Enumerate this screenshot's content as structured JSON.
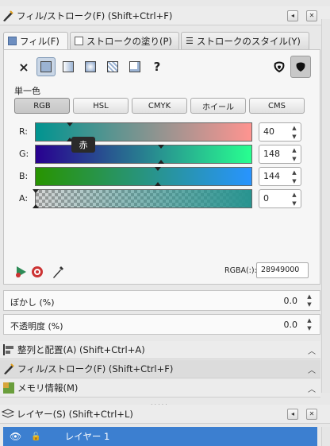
{
  "fill_stroke_panel": {
    "title": "フィル/ストローク(F) (Shift+Ctrl+F)",
    "tabs": [
      "フィル(F)",
      "ストロークの塗り(P)",
      "ストロークのスタイル(Y)"
    ],
    "paint_buttons": {
      "none": "×",
      "flat": "flat-color",
      "linear": "linear-gradient",
      "radial": "radial-gradient",
      "pattern": "pattern",
      "swatch": "swatch",
      "unset": "?"
    },
    "section_label": "単一色",
    "modes": [
      "RGB",
      "HSL",
      "CMYK",
      "ホイール",
      "CMS"
    ],
    "selected_mode": "RGB",
    "sliders": [
      {
        "label": "R:",
        "value": "40",
        "fraction": 0.157
      },
      {
        "label": "G:",
        "value": "148",
        "fraction": 0.58
      },
      {
        "label": "B:",
        "value": "144",
        "fraction": 0.565
      },
      {
        "label": "A:",
        "value": "0",
        "fraction": 0.0
      }
    ],
    "tooltip": "赤",
    "rgba_label": "RGBA(:):",
    "rgba_value": "28949000",
    "colors": {
      "current": "#289490",
      "selection": "#3c7fd0"
    }
  },
  "blur": {
    "label": "ぼかし (%)",
    "value": "0.0"
  },
  "opacity": {
    "label": "不透明度 (%)",
    "value": "0.0"
  },
  "dock": {
    "align": "整列と配置(A) (Shift+Ctrl+A)",
    "fill_stroke": "フィル/ストローク(F) (Shift+Ctrl+F)",
    "memory": "メモリ情報(M)"
  },
  "layers_panel": {
    "title": "レイヤー(S) (Shift+Ctrl+L)",
    "layer_name": "レイヤー 1"
  }
}
